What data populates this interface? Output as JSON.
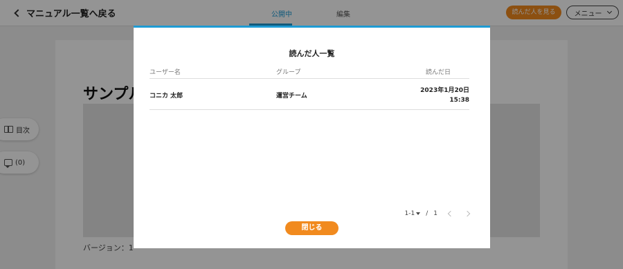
{
  "header": {
    "back_label": "マニュアル一覧へ戻る",
    "tabs": [
      {
        "label": "公開中",
        "active": true
      },
      {
        "label": "編集",
        "active": false
      }
    ],
    "read_button_label": "読んだ人を見る",
    "menu_button_label": "メニュー"
  },
  "page": {
    "title": "サンプル",
    "meta": {
      "version": "バージョン：1"
    }
  },
  "sidebar": {
    "toc_label": "目次",
    "comments_label": "(0)"
  },
  "modal": {
    "title": "読んだ人一覧",
    "columns": {
      "user": "ユーザー名",
      "group": "グループ",
      "date": "読んだ日"
    },
    "rows": [
      {
        "user": "コニカ 太郎",
        "group": "運営チーム",
        "date": "2023年1月20日",
        "time": "15:38"
      }
    ],
    "pagination": {
      "range": "1-1",
      "separator": "/",
      "total": "1"
    },
    "close_label": "閉じる"
  },
  "colors": {
    "accent_orange": "#f18a1e",
    "accent_blue": "#1e9bd4"
  }
}
